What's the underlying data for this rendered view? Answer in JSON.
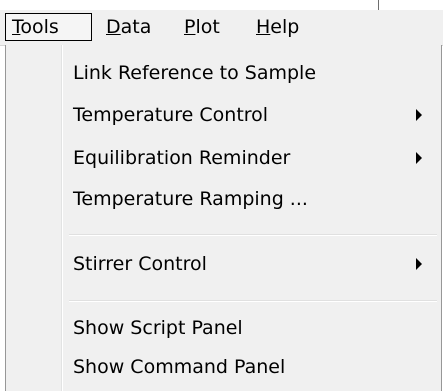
{
  "menubar": {
    "menus": [
      {
        "label": "Tools",
        "mnemonic": "T",
        "rest": "ools",
        "open": true
      },
      {
        "label": "Data",
        "mnemonic": "D",
        "rest": "ata",
        "open": false
      },
      {
        "label": "Plot",
        "mnemonic": "P",
        "rest": "lot",
        "open": false
      },
      {
        "label": "Help",
        "mnemonic": "H",
        "rest": "elp",
        "open": false
      }
    ]
  },
  "tools_menu": {
    "items": [
      {
        "label": "Link Reference to Sample",
        "submenu": false
      },
      {
        "label": "Temperature Control",
        "submenu": true
      },
      {
        "label": "Equilibration Reminder",
        "submenu": true
      },
      {
        "label": "Temperature Ramping ...",
        "submenu": false
      },
      {
        "label": "Stirrer Control",
        "submenu": true
      },
      {
        "label": "Show Script Panel",
        "submenu": false
      },
      {
        "label": "Show Command Panel",
        "submenu": false
      }
    ],
    "arrow_icon": "submenu-arrow-icon"
  },
  "colors": {
    "menu_background": "#f0f0f0",
    "separator": "#e0e0e0",
    "border": "#979797",
    "text": "#000000"
  }
}
